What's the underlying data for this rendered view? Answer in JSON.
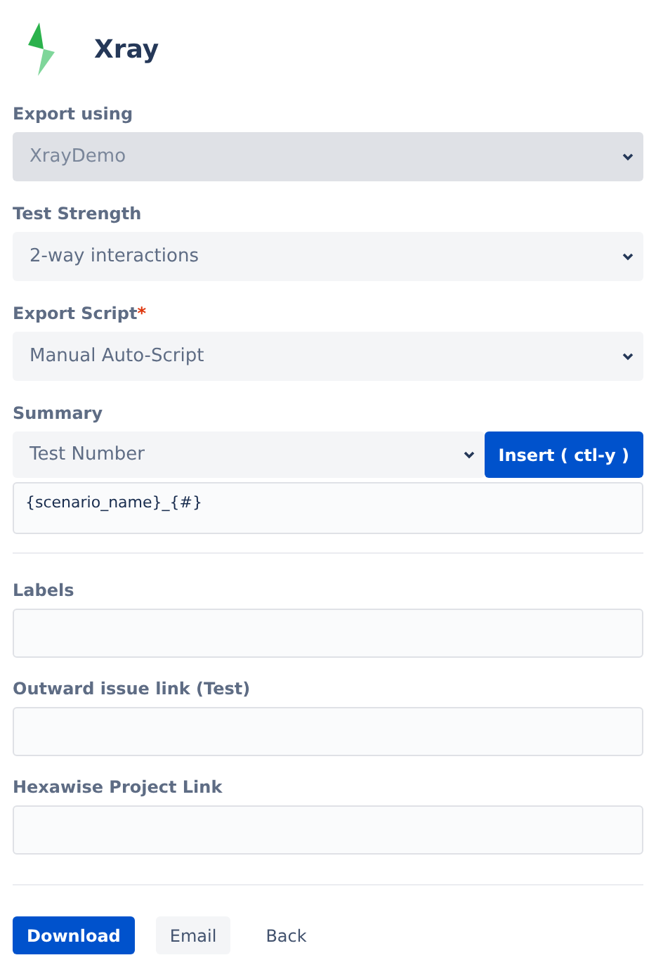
{
  "header": {
    "title": "Xray"
  },
  "required_mark": "*",
  "selects": [
    {
      "label": "Export using",
      "value": "XrayDemo",
      "disabled": true,
      "required": false
    },
    {
      "label": "Test Strength",
      "value": "2-way interactions",
      "disabled": false,
      "required": false
    },
    {
      "label": "Export Script",
      "value": "Manual Auto-Script",
      "disabled": false,
      "required": true
    }
  ],
  "summary": {
    "label": "Summary",
    "select_value": "Test Number",
    "insert_button": "Insert ( ctl-y )",
    "value": "{scenario_name}_{#}"
  },
  "text_fields": [
    {
      "label": "Labels"
    },
    {
      "label": "Outward issue link (Test)"
    },
    {
      "label": "Hexawise Project Link"
    }
  ],
  "buttons": [
    {
      "label": "Download",
      "kind": "primary"
    },
    {
      "label": "Email",
      "kind": "secondary"
    },
    {
      "label": "Back",
      "kind": "link"
    }
  ]
}
